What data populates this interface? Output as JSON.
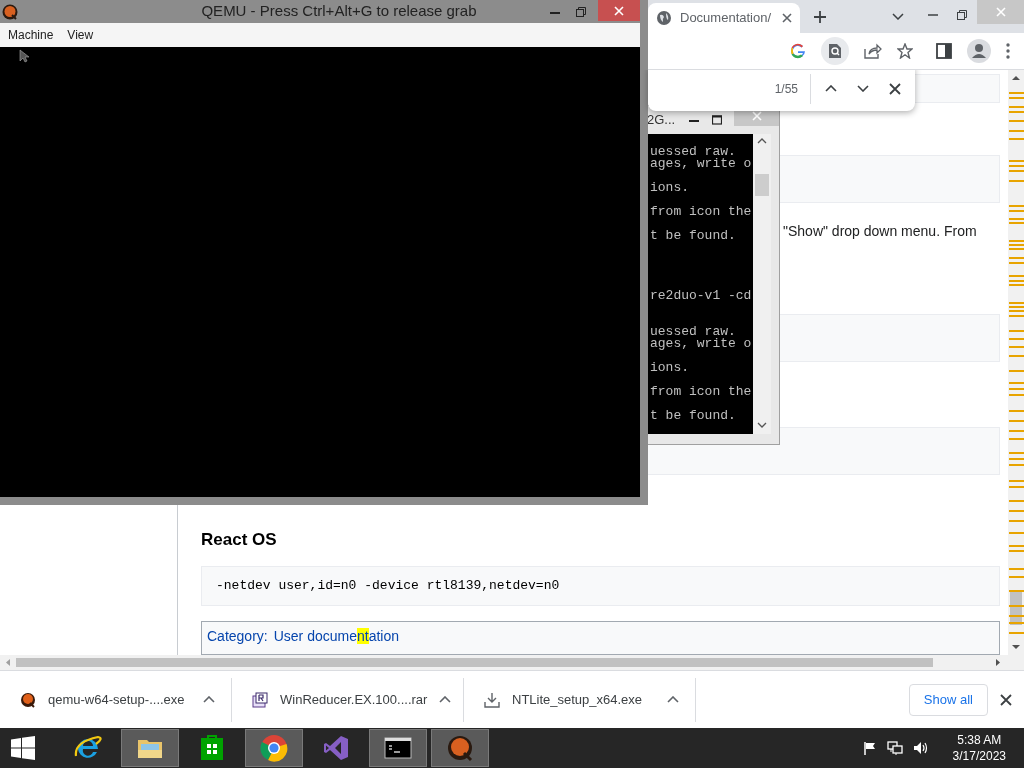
{
  "qemu_window": {
    "title": "QEMU - Press Ctrl+Alt+G to release grab",
    "menu": [
      "Machine",
      "View"
    ]
  },
  "console_window": {
    "title": "2G...",
    "blocks": [
      [
        "uessed raw.",
        "ages, write o"
      ],
      [
        "ions."
      ],
      [
        "from icon the"
      ],
      [
        "t be found."
      ],
      [
        "re2duo-v1 -cd"
      ],
      [
        "uessed raw.",
        "ages, write o"
      ],
      [
        "ions."
      ],
      [
        "from icon the"
      ],
      [
        "t be found."
      ]
    ]
  },
  "browser": {
    "tab": {
      "title": "Documentation/",
      "selected": true
    },
    "find_bar": {
      "count": "1/55"
    },
    "page": {
      "paragraph": "\"Show\" drop down menu. From",
      "heading": "React OS",
      "code": "-netdev user,id=n0 -device rtl8139,netdev=n0",
      "category_label": "Category:",
      "category_link": [
        {
          "text": "User docume",
          "highlighted": false
        },
        {
          "text": "nt",
          "highlighted": true
        },
        {
          "text": "ation",
          "highlighted": false
        }
      ]
    },
    "downloads": [
      {
        "kind": "qemu",
        "name": "qemu-w64-setup-....exe"
      },
      {
        "kind": "rar",
        "name": "WinReducer.EX.100....rar"
      },
      {
        "kind": "download",
        "name": "NTLite_setup_x64.exe"
      }
    ],
    "show_all": "Show all"
  },
  "taskbar": {
    "apps": [
      {
        "kind": "ie",
        "selected": false
      },
      {
        "kind": "explorer",
        "selected": true
      },
      {
        "kind": "store",
        "selected": false
      },
      {
        "kind": "chrome",
        "selected": true
      },
      {
        "kind": "vs",
        "selected": false
      },
      {
        "kind": "cmd",
        "selected": true
      },
      {
        "kind": "qemu",
        "selected": true
      }
    ],
    "time": "5:38 AM",
    "date": "3/17/2023"
  }
}
